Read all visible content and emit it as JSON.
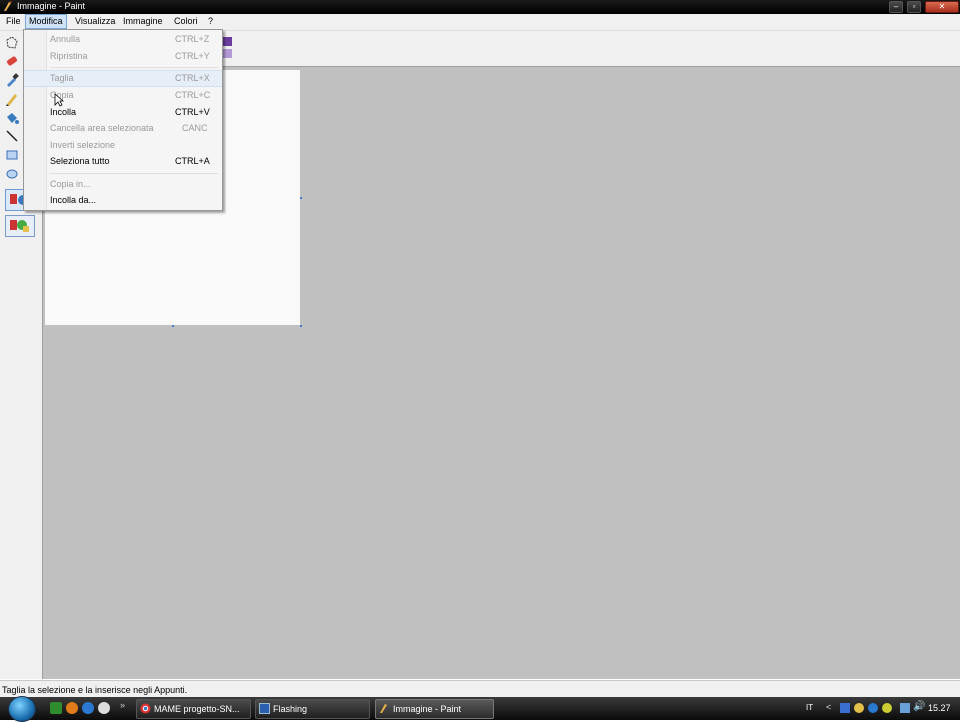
{
  "window": {
    "title": "Immagine - Paint"
  },
  "menubar": {
    "items": [
      "File",
      "Modifica",
      "Visualizza",
      "Immagine",
      "Colori",
      "?"
    ]
  },
  "dropdown": {
    "items": [
      {
        "label": "Annulla",
        "shortcut": "CTRL+Z",
        "enabled": false
      },
      {
        "label": "Ripristina",
        "shortcut": "CTRL+Y",
        "enabled": false
      },
      {
        "label": "Taglia",
        "shortcut": "CTRL+X",
        "enabled": false,
        "highlighted": true
      },
      {
        "label": "Copia",
        "shortcut": "CTRL+C",
        "enabled": false
      },
      {
        "label": "Incolla",
        "shortcut": "CTRL+V",
        "enabled": true
      },
      {
        "label": "Cancella area selezionata",
        "shortcut": "CANC",
        "enabled": false
      },
      {
        "label": "Inverti selezione",
        "shortcut": "",
        "enabled": false
      },
      {
        "label": "Seleziona tutto",
        "shortcut": "CTRL+A",
        "enabled": true
      },
      {
        "label": "Copia in...",
        "shortcut": "",
        "enabled": false
      },
      {
        "label": "Incolla da...",
        "shortcut": "",
        "enabled": true
      }
    ]
  },
  "statusbar": {
    "text": "Taglia la selezione e la inserisce negli Appunti."
  },
  "taskbar": {
    "tasks": [
      {
        "label": "MAME progetto-SN...",
        "icon": "chrome-icon"
      },
      {
        "label": "Flashing",
        "icon": "window-icon"
      },
      {
        "label": "Immagine - Paint",
        "icon": "paint-icon",
        "active": true
      }
    ],
    "language": "IT",
    "clock": "15.27"
  },
  "colors": {
    "accent_purple": "#6a3c9e",
    "canvas_bg": "#c0c0c0",
    "menu_highlight": "#cfe2f7"
  }
}
